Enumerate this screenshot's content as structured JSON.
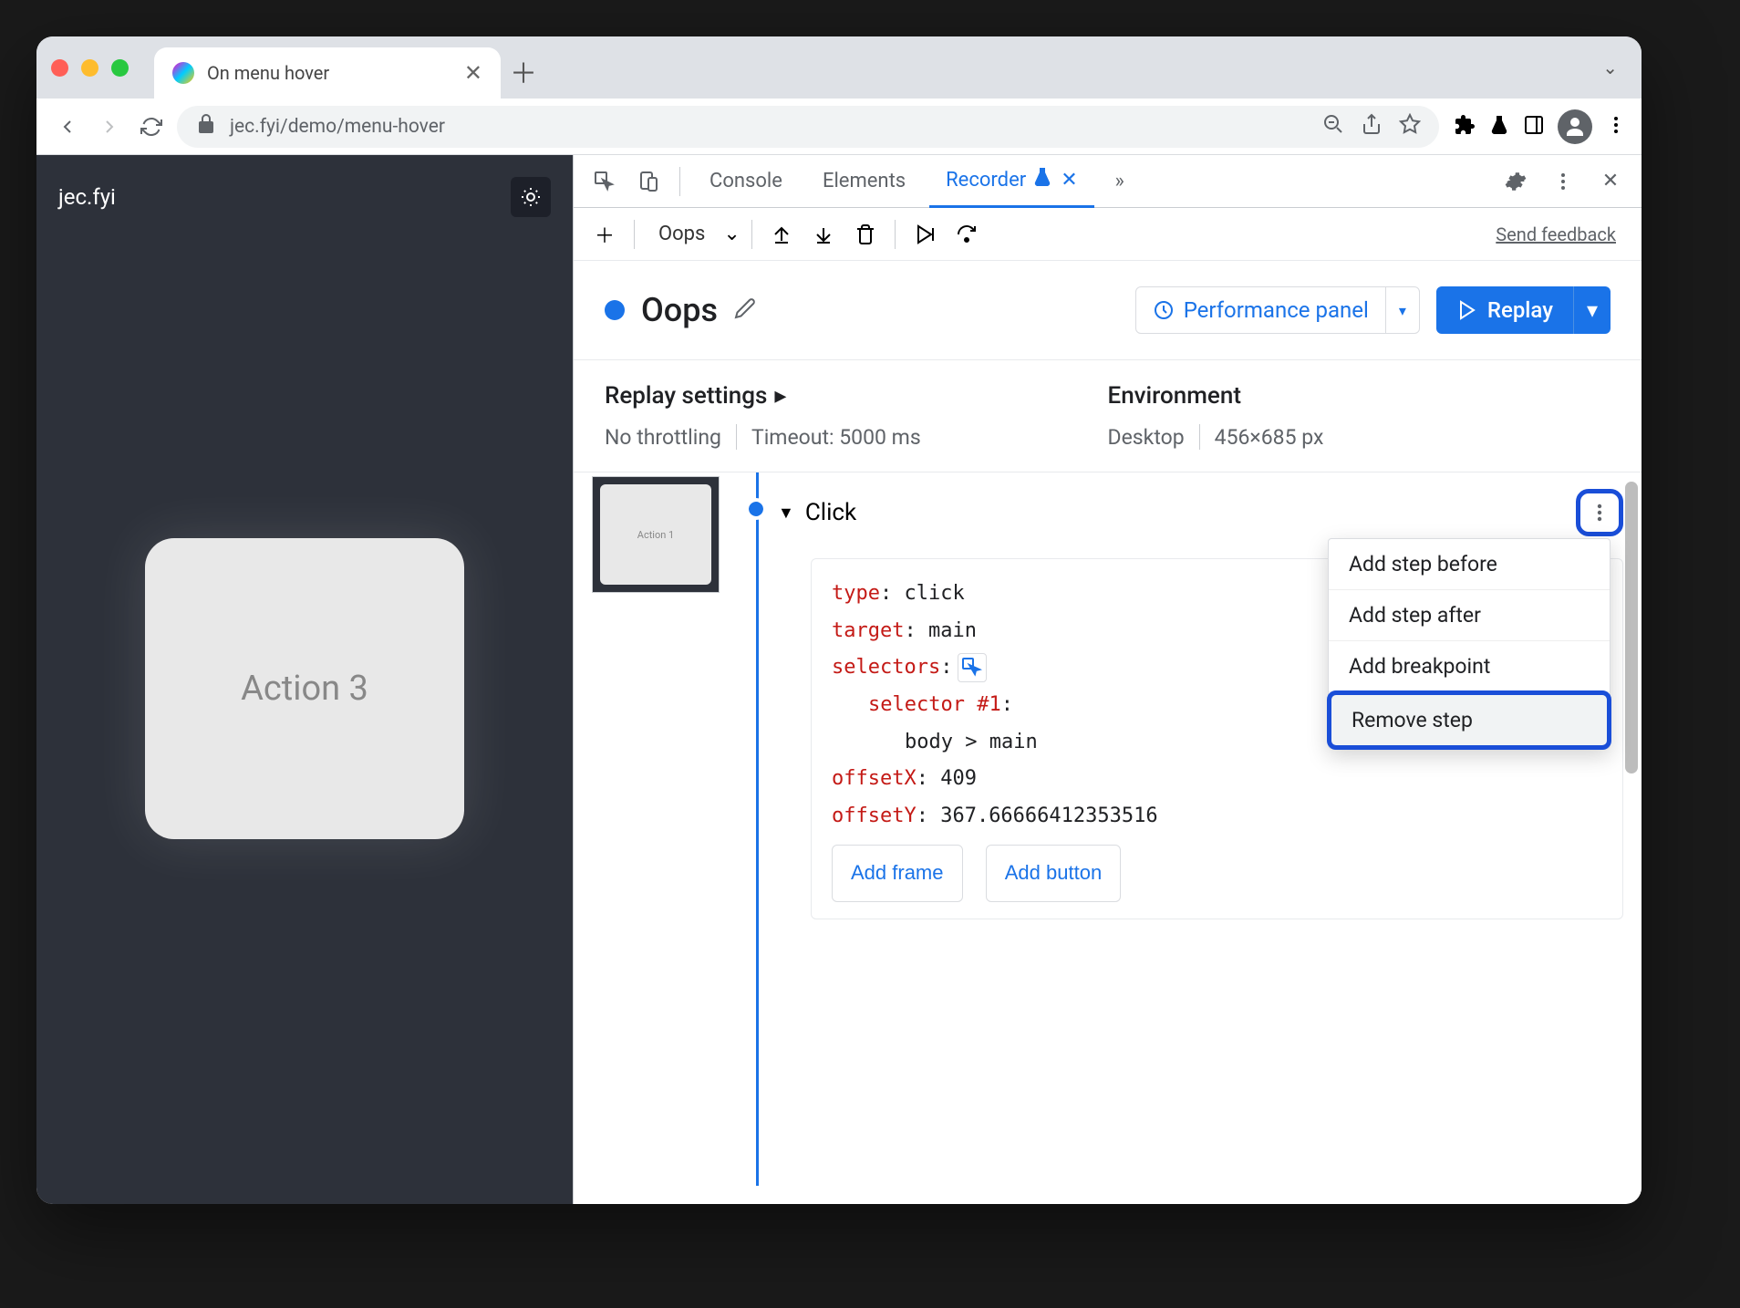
{
  "browser": {
    "tab_title": "On menu hover",
    "url": "jec.fyi/demo/menu-hover"
  },
  "page": {
    "site_title": "jec.fyi",
    "action_card": "Action 3"
  },
  "devtools": {
    "tabs": {
      "console": "Console",
      "elements": "Elements",
      "recorder": "Recorder"
    },
    "recording_name": "Oops",
    "feedback_link": "Send feedback",
    "title": "Oops",
    "perf_panel": "Performance panel",
    "replay": "Replay",
    "settings": {
      "replay_heading": "Replay settings",
      "throttling": "No throttling",
      "timeout": "Timeout: 5000 ms",
      "env_heading": "Environment",
      "device": "Desktop",
      "viewport": "456×685 px"
    },
    "thumbnail_label": "Action 1",
    "step": {
      "name": "Click",
      "type_key": "type",
      "type_val": ": click",
      "target_key": "target",
      "target_val": ": main",
      "selectors_key": "selectors",
      "selectors_val": ":",
      "selector1_key": "selector #1",
      "selector1_val": ":",
      "selector1_body": "body > main",
      "offsetx_key": "offsetX",
      "offsetx_val": ": 409",
      "offsety_key": "offsetY",
      "offsety_val": ": 367.66666412353516",
      "add_frame": "Add frame",
      "add_button": "Add button"
    },
    "context_menu": {
      "before": "Add step before",
      "after": "Add step after",
      "breakpoint": "Add breakpoint",
      "remove": "Remove step"
    }
  }
}
